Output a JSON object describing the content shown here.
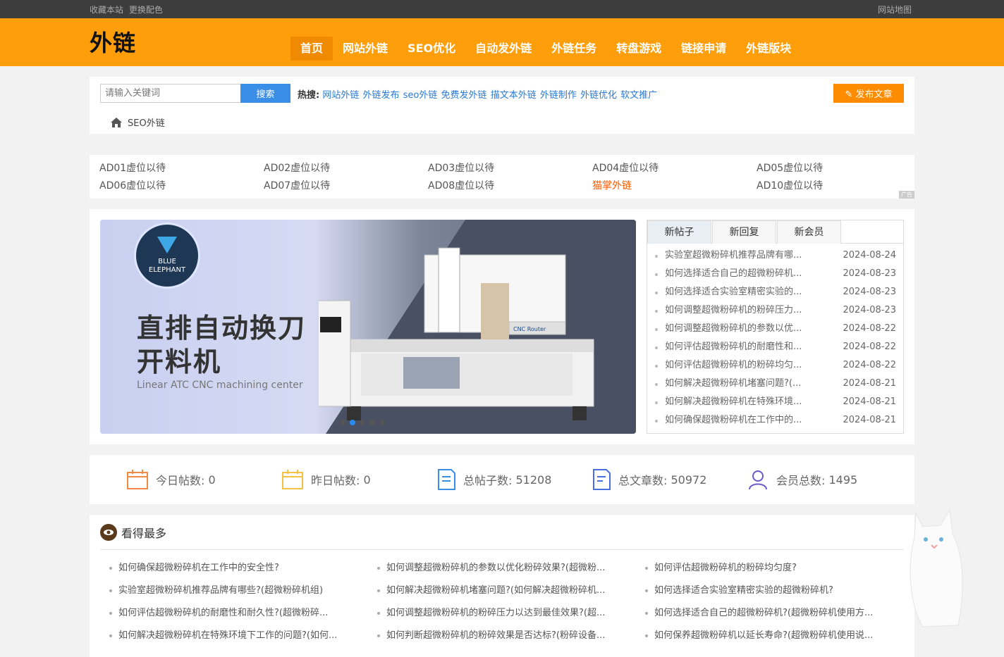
{
  "topbar": {
    "favorite": "收藏本站",
    "theme": "更换配色",
    "sitemap": "网站地图"
  },
  "header": {
    "logo": "外链",
    "nav": [
      "首页",
      "网站外链",
      "SEO优化",
      "自动发外链",
      "外链任务",
      "转盘游戏",
      "链接申请",
      "外链版块"
    ]
  },
  "search": {
    "placeholder": "请输入关键词",
    "button": "搜索",
    "hot_label": "热搜:",
    "hot_links": [
      "网站外链",
      "外链发布",
      "seo外链",
      "免费发外链",
      "描文本外链",
      "外链制作",
      "外链优化",
      "软文推广"
    ],
    "publish": "发布文章"
  },
  "breadcrumb": "SEO外链",
  "ads": [
    "AD01虚位以待",
    "AD02虚位以待",
    "AD03虚位以待",
    "AD04虚位以待",
    "AD05虚位以待",
    "AD06虚位以待",
    "AD07虚位以待",
    "AD08虚位以待",
    "猫掌外链",
    "AD10虚位以待"
  ],
  "ad_tag": "广告",
  "banner": {
    "brand_line1": "BLUE",
    "brand_line2": "ELEPHANT",
    "title_line1": "直排自动换刀",
    "title_line2": "开料机",
    "subtitle": "Linear ATC CNC machining center",
    "machine_label": "CNC Router"
  },
  "tabs": [
    "新帖子",
    "新回复",
    "新会员"
  ],
  "posts": [
    {
      "title": "实验室超微粉碎机推荐品牌有哪...",
      "date": "2024-08-24"
    },
    {
      "title": "如何选择适合自己的超微粉碎机...",
      "date": "2024-08-23"
    },
    {
      "title": "如何选择适合实验室精密实验的...",
      "date": "2024-08-23"
    },
    {
      "title": "如何调整超微粉碎机的粉碎压力...",
      "date": "2024-08-23"
    },
    {
      "title": "如何调整超微粉碎机的参数以优...",
      "date": "2024-08-22"
    },
    {
      "title": "如何评估超微粉碎机的耐磨性和...",
      "date": "2024-08-22"
    },
    {
      "title": "如何评估超微粉碎机的粉碎均匀...",
      "date": "2024-08-22"
    },
    {
      "title": "如何解决超微粉碎机堵塞问题?(...",
      "date": "2024-08-21"
    },
    {
      "title": "如何解决超微粉碎机在特殊环境...",
      "date": "2024-08-21"
    },
    {
      "title": "如何确保超微粉碎机在工作中的...",
      "date": "2024-08-21"
    }
  ],
  "stats": [
    {
      "label": "今日帖数:",
      "value": "0",
      "color": "#f08b45"
    },
    {
      "label": "昨日帖数:",
      "value": "0",
      "color": "#f5c142"
    },
    {
      "label": "总帖子数:",
      "value": "51208",
      "color": "#3a8ee6"
    },
    {
      "label": "总文章数:",
      "value": "50972",
      "color": "#4a6de0"
    },
    {
      "label": "会员总数:",
      "value": "1495",
      "color": "#6a5acd"
    }
  ],
  "most_viewed": {
    "title": "看得最多",
    "items": [
      "如何确保超微粉碎机在工作中的安全性?",
      "如何调整超微粉碎机的参数以优化粉碎效果?(超微粉...",
      "如何评估超微粉碎机的粉碎均匀度?",
      "实验室超微粉碎机推荐品牌有哪些?(超微粉碎机组)",
      "如何解决超微粉碎机堵塞问题?(如何解决超微粉碎机...",
      "如何选择适合实验室精密实验的超微粉碎机?",
      "如何评估超微粉碎机的耐磨性和耐久性?(超微粉碎...",
      "如何调整超微粉碎机的粉碎压力以达到最佳效果?(超...",
      "如何选择适合自己的超微粉碎机?(超微粉碎机使用方...",
      "如何解决超微粉碎机在特殊环境下工作的问题?(如何...",
      "如何判断超微粉碎机的粉碎效果是否达标?(粉碎设备...",
      "如何保养超微粉碎机以延长寿命?(超微粉碎机使用说..."
    ]
  }
}
